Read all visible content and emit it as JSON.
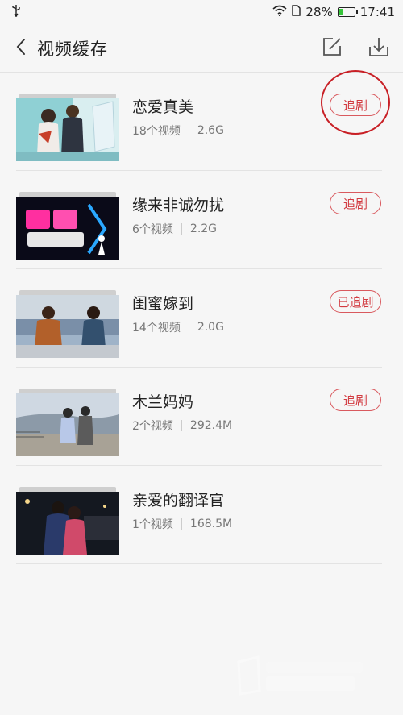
{
  "status_bar": {
    "usb_icon": "usb-icon",
    "wifi_icon": "wifi-icon",
    "sim_icon": "sim-icon",
    "battery_percent": "28%",
    "battery_level": 0.28,
    "battery_color": "#36c43a",
    "time": "17:41"
  },
  "header": {
    "title": "视频缓存",
    "back_icon": "back-icon",
    "edit_icon": "edit-icon",
    "download_icon": "download-icon"
  },
  "items": [
    {
      "title": "恋爱真美",
      "count": "18个视频",
      "size": "2.6G",
      "action": "追剧",
      "thumb_colors": [
        "#8fd0d4",
        "#e5e5e5",
        "#6a4a3a"
      ]
    },
    {
      "title": "缘来非诚勿扰",
      "count": "6个视频",
      "size": "2.2G",
      "action": "追剧",
      "thumb_colors": [
        "#0a0a18",
        "#ff2fa0",
        "#2aa8ff"
      ]
    },
    {
      "title": "闺蜜嫁到",
      "count": "14个视频",
      "size": "2.0G",
      "action": "已追剧",
      "thumb_colors": [
        "#7a8fa8",
        "#b2602a",
        "#2a4a6a"
      ]
    },
    {
      "title": "木兰妈妈",
      "count": "2个视频",
      "size": "292.4M",
      "action": "追剧",
      "thumb_colors": [
        "#cfd8e2",
        "#5b5b5b",
        "#b8c8e8"
      ]
    },
    {
      "title": "亲爱的翻译官",
      "count": "1个视频",
      "size": "168.5M",
      "action": "",
      "thumb_colors": [
        "#141820",
        "#2a3a6a",
        "#d04a6a"
      ]
    }
  ],
  "accent_color": "#d23a40"
}
